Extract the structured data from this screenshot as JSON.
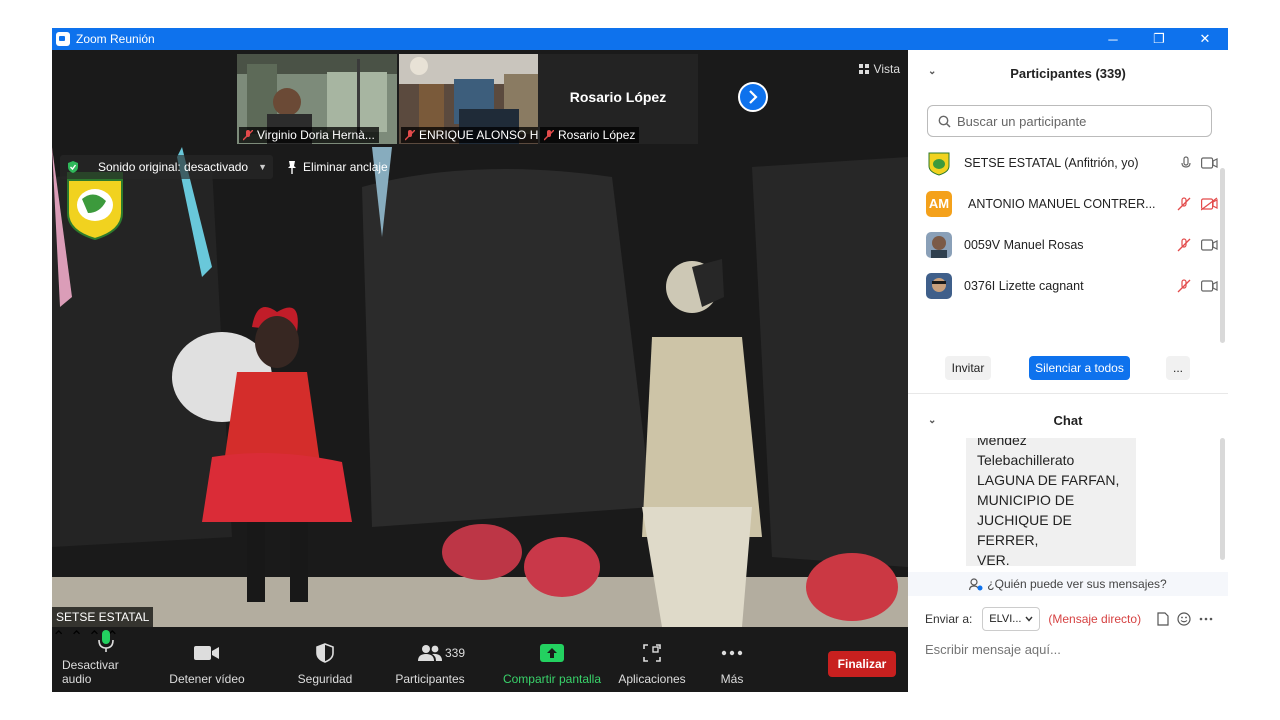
{
  "window": {
    "title": "Zoom Reunión",
    "controls": [
      "─",
      "❐",
      "✕"
    ]
  },
  "strip": {
    "thumbs": [
      {
        "name": "Virginio Doria Hernà..."
      },
      {
        "name": "ENRIQUE ALONSO H..."
      }
    ],
    "name_only_tile": {
      "big_name": "Rosario López",
      "label": "Rosario López"
    },
    "view_label": "Vista"
  },
  "video": {
    "sound_label": "Sonido original: desactivado",
    "unpin_label": "Eliminar anclaje",
    "speaker_name": "SETSE ESTATAL"
  },
  "controls": {
    "mute_label": "Desactivar audio",
    "video_label": "Detener vídeo",
    "security_label": "Seguridad",
    "participants_label": "Participantes",
    "participants_count": "339",
    "share_label": "Compartir pantalla",
    "apps_label": "Aplicaciones",
    "more_label": "Más",
    "end_label": "Finalizar"
  },
  "participants_panel": {
    "title": "Participantes (339)",
    "search_placeholder": "Buscar un participante",
    "items": [
      {
        "name": "SETSE ESTATAL (Anfitrión, yo)",
        "avatar": "logo",
        "muted": false,
        "video_off": false
      },
      {
        "name": "ANTONIO MANUEL CONTRER...",
        "avatar": "AM",
        "muted": true,
        "video_off": true
      },
      {
        "name": "0059V Manuel Rosas",
        "avatar": "photo",
        "muted": true,
        "video_off": false
      },
      {
        "name": "0376I Lizette cagnant",
        "avatar": "photo",
        "muted": true,
        "video_off": false
      }
    ],
    "invite_label": "Invitar",
    "mute_all_label": "Silenciar a todos",
    "more_label": "..."
  },
  "chat_panel": {
    "title": "Chat",
    "message_lines": [
      "Mendez",
      "Telebachillerato",
      "LAGUNA DE FARFAN,",
      "MUNICIPIO DE",
      "JUCHIQUE DE FERRER,",
      "VER."
    ],
    "who_sees": "¿Quién puede ver sus mensajes?",
    "send_to_label": "Enviar a:",
    "recipient": "ELVI...",
    "direct_label": "(Mensaje directo)",
    "input_placeholder": "Escribir mensaje aquí..."
  },
  "colors": {
    "accent": "#0e72ed",
    "end": "#c8201f",
    "share": "#39d26a",
    "mute_red": "#e34b4b"
  }
}
